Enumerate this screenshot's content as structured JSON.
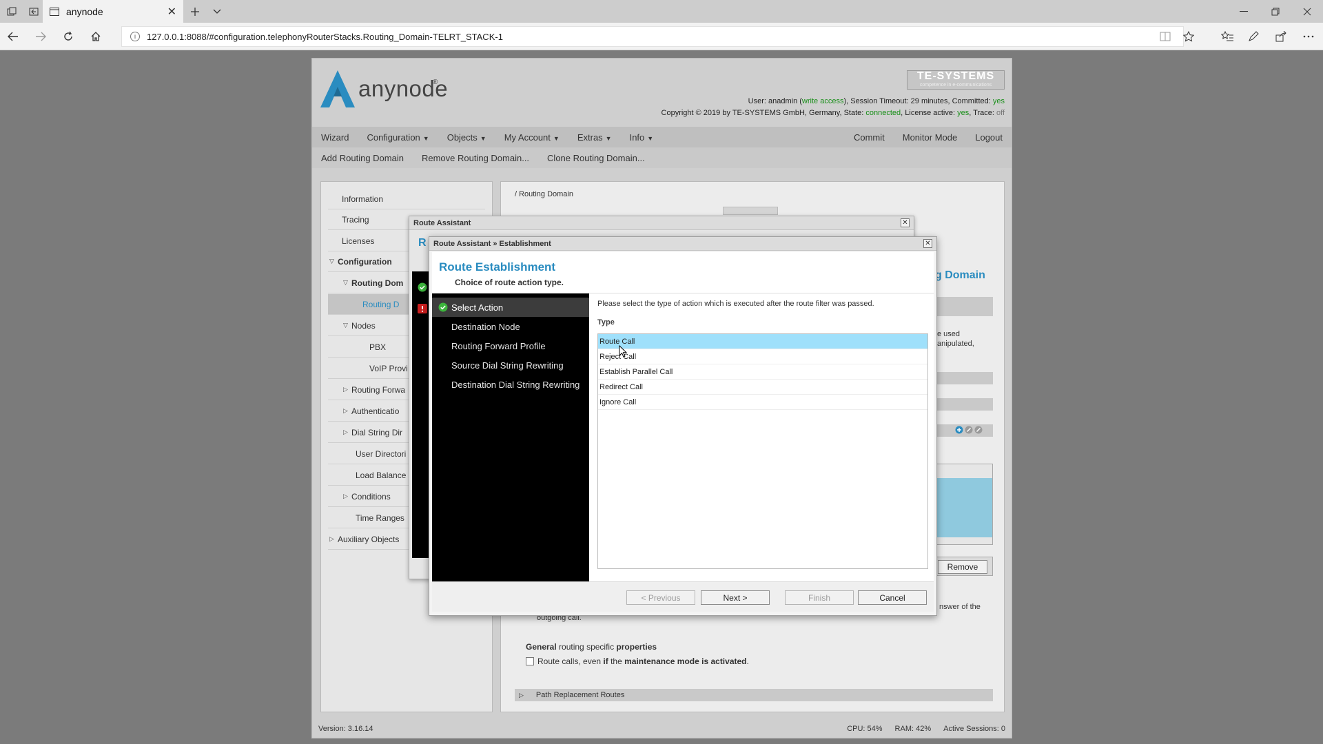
{
  "browser": {
    "tab_title": "anynode",
    "url": "127.0.0.1:8088/#configuration.telephonyRouterStacks.Routing_Domain-TELRT_STACK-1"
  },
  "header": {
    "app_name": "anynode",
    "brand": "TE-SYSTEMS",
    "brand_tagline": "competence in e-communications",
    "user_line": {
      "prefix": "User: anadmin (",
      "access": "write access",
      "suffix": "), Session Timeout: 29 minutes, Committed: ",
      "committed": "yes"
    },
    "copyright_line": {
      "prefix": "Copyright © 2019 by TE-SYSTEMS GmbH, Germany, State: ",
      "state": "connected",
      "mid": ", License active: ",
      "license": "yes",
      "mid2": ", Trace: ",
      "trace": "off"
    }
  },
  "menu": {
    "wizard": "Wizard",
    "configuration": "Configuration",
    "objects": "Objects",
    "my_account": "My Account",
    "extras": "Extras",
    "info": "Info",
    "commit": "Commit",
    "monitor_mode": "Monitor Mode",
    "logout": "Logout"
  },
  "submenu": {
    "add": "Add Routing Domain",
    "remove": "Remove Routing Domain...",
    "clone": "Clone Routing Domain..."
  },
  "leftnav": {
    "information": "Information",
    "tracing": "Tracing",
    "licenses": "Licenses",
    "configuration": "Configuration",
    "routing_domains": "Routing Dom",
    "routing_domain_item": "Routing D",
    "nodes": "Nodes",
    "pbx": "PBX",
    "voip": "VoIP Provi",
    "routing_forward": "Routing Forwa",
    "authentication": "Authenticatio",
    "dial_string": "Dial String Dir",
    "user_directories": "User Directori",
    "load_balancer": "Load Balance",
    "conditions": "Conditions",
    "time_ranges": "Time Ranges",
    "auxiliary": "Auxiliary Objects"
  },
  "rightpanel": {
    "breadcrumb": "/ Routing Domain",
    "heading_fragment": "g Domain",
    "desc_line1": "e used",
    "desc_line2": "anipulated,",
    "remove_button": "Remove",
    "answer_text": "nswer of the",
    "outgoing_text": "outgoing call.",
    "general_prefix": "General",
    "general_mid": " routing specific ",
    "general_suffix": "properties",
    "checkbox_a": "Route calls, even ",
    "checkbox_b": "if",
    "checkbox_c": " the ",
    "checkbox_d": "maintenance mode is activated",
    "checkbox_e": ".",
    "path_replacement": "Path Replacement Routes"
  },
  "status": {
    "version": "Version: 3.16.14",
    "cpu": "CPU: 54%",
    "ram": "RAM: 42%",
    "sessions": "Active Sessions: 0"
  },
  "dialog_outer": {
    "title": "Route Assistant",
    "heading_fragment": "R"
  },
  "dialog": {
    "title": "Route Assistant » Establishment",
    "heading": "Route Establishment",
    "subheading": "Choice of route action type.",
    "steps": [
      "Select Action",
      "Destination Node",
      "Routing Forward Profile",
      "Source Dial String Rewriting",
      "Destination Dial String Rewriting"
    ],
    "instruction": "Please select the type of action which is executed after the route filter was passed.",
    "type_label": "Type",
    "types": [
      "Route Call",
      "Reject Call",
      "Establish Parallel Call",
      "Redirect Call",
      "Ignore Call"
    ],
    "selected_type": "Route Call",
    "buttons": {
      "previous": "< Previous",
      "next": "Next >",
      "finish": "Finish",
      "cancel": "Cancel"
    }
  },
  "colors": {
    "accent": "#2a8cc0",
    "selection": "#9fe0fb",
    "ok": "#1a8f1a",
    "error": "#cc1f1f"
  }
}
